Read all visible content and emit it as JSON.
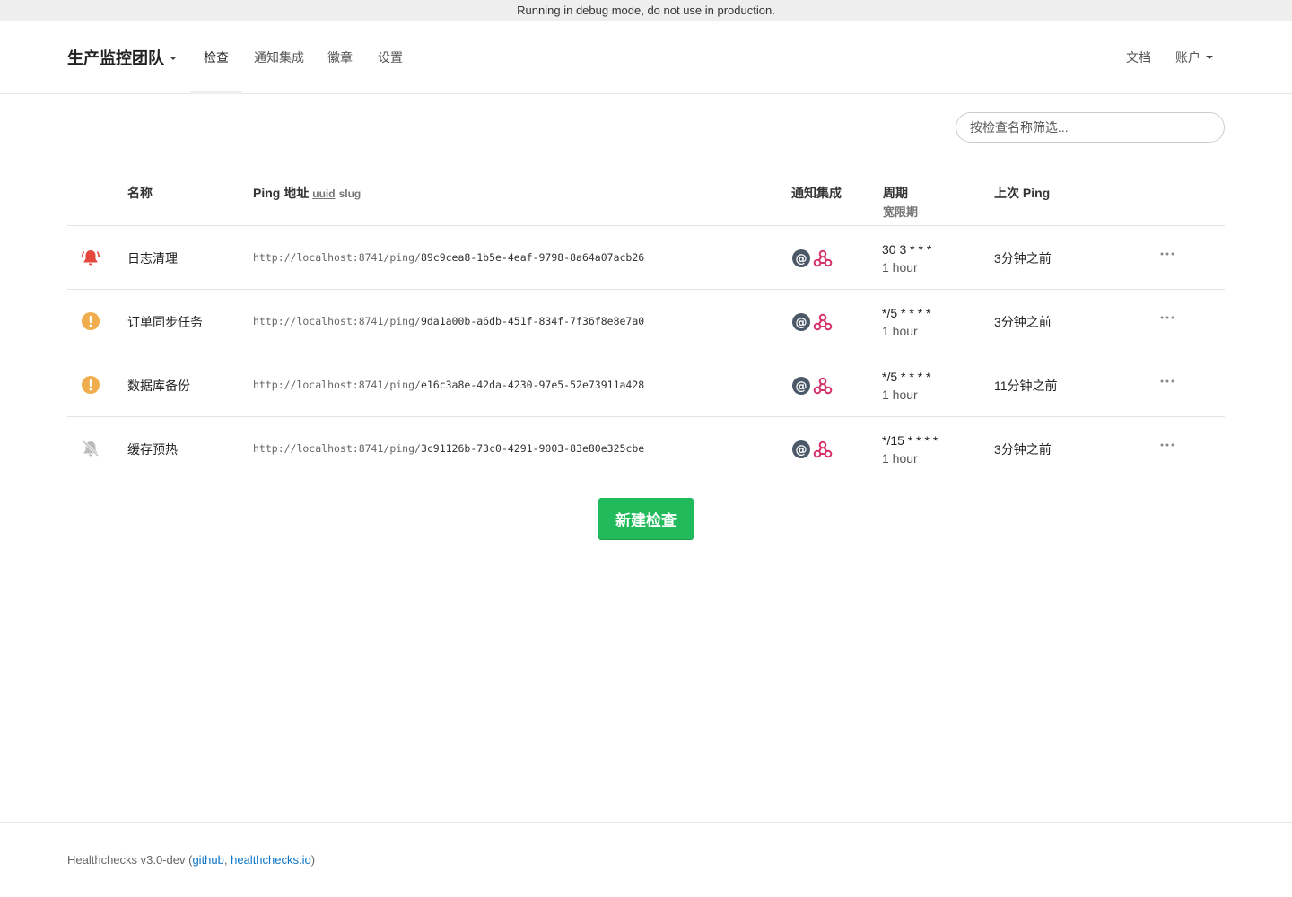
{
  "debug_banner": "Running in debug mode, do not use in production.",
  "nav": {
    "project": "生产监控团队",
    "items": [
      "检查",
      "通知集成",
      "徽章",
      "设置"
    ],
    "active_index": 0,
    "docs": "文档",
    "account": "账户"
  },
  "filter": {
    "placeholder": "按检查名称筛选..."
  },
  "table": {
    "headers": {
      "name": "名称",
      "ping": "Ping 地址",
      "ping_uuid": "uuid",
      "ping_slug": "slug",
      "integrations": "通知集成",
      "period": "周期",
      "grace": "宽限期",
      "last_ping": "上次 Ping"
    },
    "rows": [
      {
        "status": "down",
        "status_icon": "bell-ringing-icon",
        "name": "日志清理",
        "url_base": "http://localhost:8741/ping/",
        "uuid": "89c9cea8-1b5e-4eaf-9798-8a64a07acb26",
        "schedule": "30 3 * * *",
        "grace": "1 hour",
        "last_ping": "3分钟之前"
      },
      {
        "status": "grace",
        "status_icon": "exclamation-circle-icon",
        "name": "订单同步任务",
        "url_base": "http://localhost:8741/ping/",
        "uuid": "9da1a00b-a6db-451f-834f-7f36f8e8e7a0",
        "schedule": "*/5 * * * *",
        "grace": "1 hour",
        "last_ping": "3分钟之前"
      },
      {
        "status": "grace",
        "status_icon": "exclamation-circle-icon",
        "name": "数据库备份",
        "url_base": "http://localhost:8741/ping/",
        "uuid": "e16c3a8e-42da-4230-97e5-52e73911a428",
        "schedule": "*/5 * * * *",
        "grace": "1 hour",
        "last_ping": "11分钟之前"
      },
      {
        "status": "paused",
        "status_icon": "bell-muted-icon",
        "name": "缓存预热",
        "url_base": "http://localhost:8741/ping/",
        "uuid": "3c91126b-73c0-4291-9003-83e80e325cbe",
        "schedule": "*/15 * * * *",
        "grace": "1 hour",
        "last_ping": "3分钟之前"
      }
    ]
  },
  "new_check_button": "新建检查",
  "footer": {
    "prefix": "Healthchecks v3.0-dev (",
    "link1": "github",
    "sep": ", ",
    "link2": "healthchecks.io",
    "suffix": ")"
  },
  "colors": {
    "down": "#e4473d",
    "grace": "#f0ad4e",
    "paused": "#bbbbbb",
    "primary_button": "#22bb5c",
    "link": "#0a74c7",
    "email_icon": "#4a5868",
    "webhook_icon": "#d6316b"
  }
}
